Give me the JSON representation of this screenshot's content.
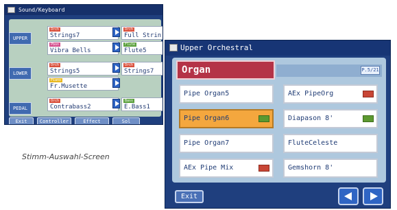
{
  "sound_keyboard": {
    "title": "Sound/Keyboard",
    "parts": [
      {
        "label": "UPPER",
        "slots": [
          {
            "category": "Orch",
            "category_color": "#d9503c",
            "name": "Strings7"
          },
          {
            "category": "Orch",
            "category_color": "#d9503c",
            "name": "Full Strin"
          },
          {
            "category": "Pbon",
            "category_color": "#d44c8c",
            "name": "Vibra Bells"
          },
          {
            "category": "Flute",
            "category_color": "#5aa03c",
            "name": "Flute5"
          }
        ]
      },
      {
        "label": "LOWER",
        "slots": [
          {
            "category": "Orch",
            "category_color": "#d9503c",
            "name": "Strings5"
          },
          {
            "category": "Orch",
            "category_color": "#d9503c",
            "name": "Strings7"
          },
          {
            "category": "Piano",
            "category_color": "#e8b820",
            "name": "Fr.Musette"
          }
        ]
      },
      {
        "label": "PEDAL",
        "slots": [
          {
            "category": "Orch",
            "category_color": "#d9503c",
            "name": "Contrabass2"
          },
          {
            "category": "Bass",
            "category_color": "#5aa03c",
            "name": "E.Bass1"
          }
        ]
      }
    ],
    "buttons": {
      "exit": "Exit",
      "controller": "Controller",
      "effect": "Effect",
      "sol": "Sol"
    }
  },
  "caption": "Stimm-Auswahl-Screen",
  "upper_orchestral": {
    "title": "Upper Orchestral",
    "category": "Organ",
    "page_indicator": "P.5/21",
    "tones": [
      {
        "name": "Pipe Organ5",
        "selected": false,
        "badge": "none"
      },
      {
        "name": "AEx PipeOrg",
        "selected": false,
        "badge": "red"
      },
      {
        "name": "Pipe Organ6",
        "selected": true,
        "badge": "green"
      },
      {
        "name": "Diapason 8'",
        "selected": false,
        "badge": "green"
      },
      {
        "name": "Pipe Organ7",
        "selected": false,
        "badge": "none"
      },
      {
        "name": "FluteCeleste",
        "selected": false,
        "badge": "none"
      },
      {
        "name": "AEx Pipe Mix",
        "selected": false,
        "badge": "red"
      },
      {
        "name": "Gemshorn 8'",
        "selected": false,
        "badge": "none"
      }
    ],
    "exit_label": "Exit",
    "nav_icons": [
      "arrow-left-icon",
      "arrow-right-icon"
    ],
    "colors": {
      "screen_bg": "#1f3f7e",
      "panel_bg": "#aec8de",
      "category_bar": "#b43347",
      "selected_tone": "#f4a73e"
    }
  }
}
